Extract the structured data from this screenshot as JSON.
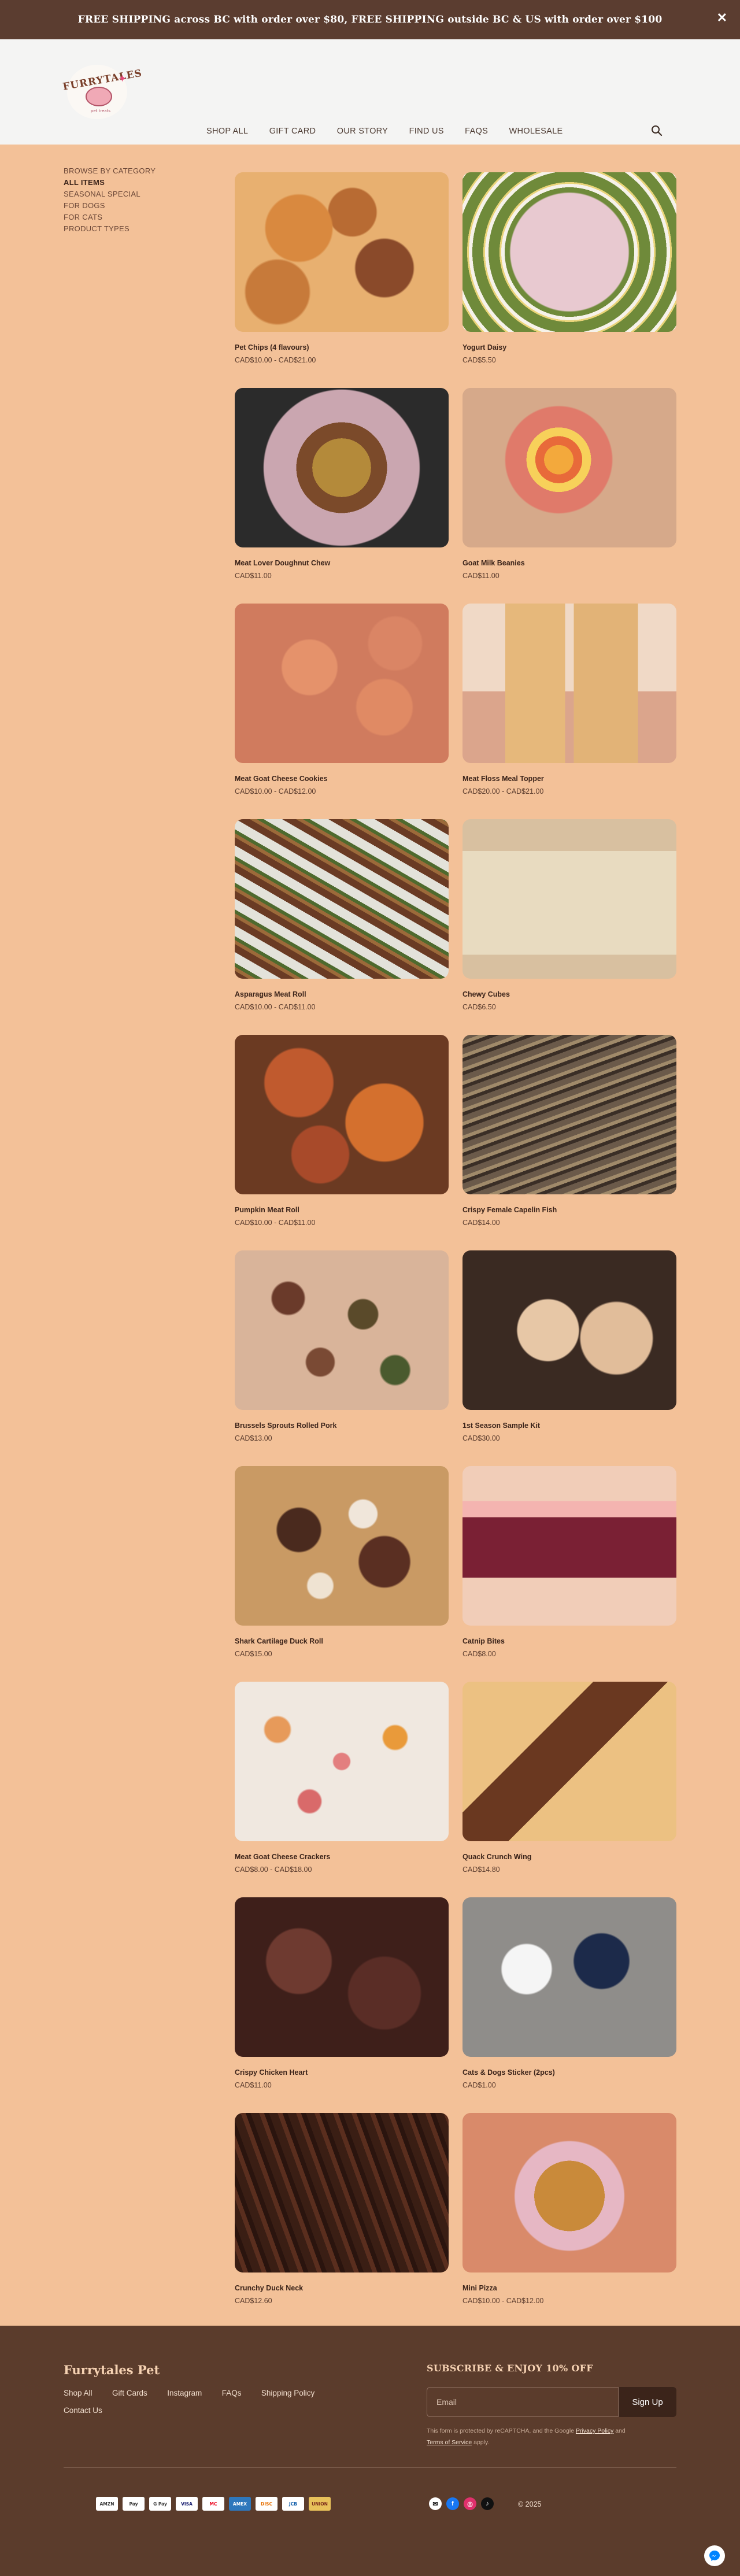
{
  "announcement": {
    "text": "FREE SHIPPING across BC with order over $80, FREE SHIPPING outside BC & US with order over $100",
    "close": "✕"
  },
  "header": {
    "logo_text": "FURRYTALES",
    "logo_tagline": "pet treats",
    "nav": [
      "SHOP ALL",
      "GIFT CARD",
      "OUR STORY",
      "FIND US",
      "FAQS",
      "WHOLESALE"
    ]
  },
  "sidebar": {
    "items": [
      "BROWSE BY CATEGORY",
      "ALL ITEMS",
      "SEASONAL SPECIAL",
      "FOR DOGS",
      "FOR CATS",
      "PRODUCT TYPES"
    ]
  },
  "products": [
    {
      "name": "Pet Chips (4 flavours)",
      "price": "CAD$10.00 - CAD$21.00"
    },
    {
      "name": "Yogurt Daisy",
      "price": "CAD$5.50"
    },
    {
      "name": "Meat Lover Doughnut Chew",
      "price": "CAD$11.00"
    },
    {
      "name": "Goat Milk Beanies",
      "price": "CAD$11.00"
    },
    {
      "name": "Meat Goat Cheese Cookies",
      "price": "CAD$10.00 - CAD$12.00"
    },
    {
      "name": "Meat Floss Meal Topper",
      "price": "CAD$20.00 - CAD$21.00"
    },
    {
      "name": "Asparagus Meat Roll",
      "price": "CAD$10.00 - CAD$11.00"
    },
    {
      "name": "Chewy Cubes",
      "price": "CAD$6.50"
    },
    {
      "name": "Pumpkin Meat Roll",
      "price": "CAD$10.00 - CAD$11.00"
    },
    {
      "name": "Crispy Female Capelin Fish",
      "price": "CAD$14.00"
    },
    {
      "name": "Brussels Sprouts Rolled Pork",
      "price": "CAD$13.00"
    },
    {
      "name": "1st Season Sample Kit",
      "price": "CAD$30.00"
    },
    {
      "name": "Shark Cartilage Duck Roll",
      "price": "CAD$15.00"
    },
    {
      "name": "Catnip Bites",
      "price": "CAD$8.00"
    },
    {
      "name": "Meat Goat Cheese Crackers",
      "price": "CAD$8.00 - CAD$18.00"
    },
    {
      "name": "Quack Crunch Wing",
      "price": "CAD$14.80"
    },
    {
      "name": "Crispy Chicken Heart",
      "price": "CAD$11.00"
    },
    {
      "name": "Cats & Dogs Sticker (2pcs)",
      "price": "CAD$1.00"
    },
    {
      "name": "Crunchy Duck Neck",
      "price": "CAD$12.60"
    },
    {
      "name": "Mini Pizza",
      "price": "CAD$10.00 - CAD$12.00"
    }
  ],
  "footer": {
    "brand": "Furrytales Pet",
    "links": [
      "Shop All",
      "Gift Cards",
      "Instagram",
      "FAQs",
      "Shipping Policy",
      "Contact Us"
    ],
    "subscribe_title": "SUBSCRIBE & ENJOY 10% OFF",
    "email_placeholder": "Email",
    "signup": "Sign Up",
    "recaptcha_prefix": "This form is protected by reCAPTCHA, and the Google",
    "privacy": "Privacy Policy",
    "and": "and",
    "terms": "Terms of Service",
    "apply": "apply.",
    "payments": [
      "AMZN",
      "Pay",
      "G Pay",
      "VISA",
      "MC",
      "AMEX",
      "DISC",
      "JCB",
      "UNION"
    ],
    "copyright": "© 2025"
  },
  "colors": {
    "page_bg": "#f3c198",
    "announce_bg": "#5b3d30",
    "header_bg": "#f4f4f3",
    "footer_bg": "#5b3c2c",
    "button_bg": "#3b241a"
  }
}
